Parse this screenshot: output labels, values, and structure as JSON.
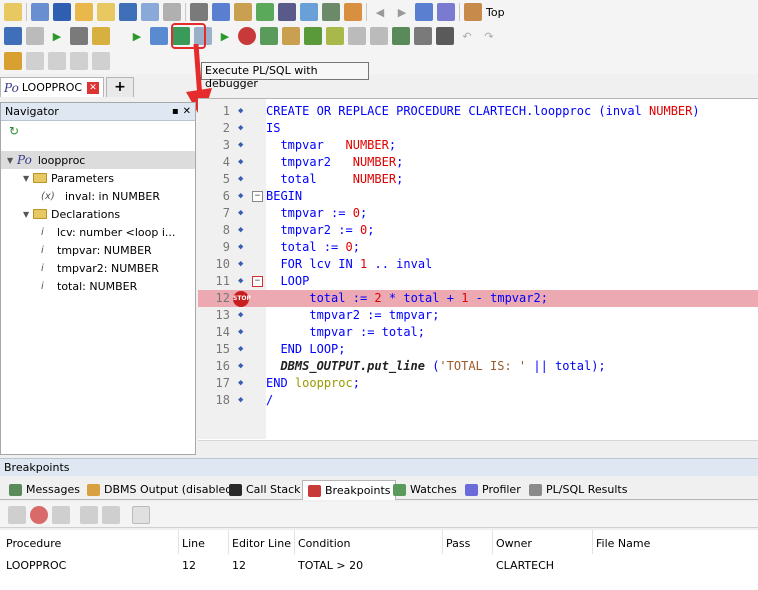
{
  "toolbar": {
    "top_label": "Top",
    "execute_debugger_tooltip": "Execute PL/SQL with debugger"
  },
  "tabs": {
    "document_prefix": "Po",
    "document": "LOOPPROC",
    "add": "+"
  },
  "navigator": {
    "title": "Navigator",
    "tree": [
      {
        "label": "loopproc",
        "prefix": "Po",
        "level": 0
      },
      {
        "label": "Parameters",
        "level": 1
      },
      {
        "label": "inval: in NUMBER",
        "prefix": "(x)",
        "level": 2
      },
      {
        "label": "Declarations",
        "level": 1
      },
      {
        "label": "lcv: number <loop i...",
        "level": 2
      },
      {
        "label": "tmpvar: NUMBER",
        "level": 2
      },
      {
        "label": "tmpvar2: NUMBER",
        "level": 2
      },
      {
        "label": "total: NUMBER",
        "level": 2
      }
    ]
  },
  "editor": {
    "breakpoint_line": 12,
    "lines": [
      "CREATE OR REPLACE PROCEDURE CLARTECH.loopproc (inval NUMBER)",
      "IS",
      "  tmpvar   NUMBER;",
      "  tmpvar2   NUMBER;",
      "  total     NUMBER;",
      "BEGIN",
      "  tmpvar := 0;",
      "  tmpvar2 := 0;",
      "  total := 0;",
      "  FOR lcv IN 1 .. inval",
      "  LOOP",
      "      total := 2 * total + 1 - tmpvar2;",
      "      tmpvar2 := tmpvar;",
      "      tmpvar := total;",
      "  END LOOP;",
      "  DBMS_OUTPUT.put_line ('TOTAL IS: ' || total);",
      "END loopproc;",
      "/"
    ]
  },
  "bottom": {
    "section_title": "Breakpoints",
    "tabs": [
      "Messages",
      "DBMS Output (disabled)",
      "Call Stack",
      "Breakpoints",
      "Watches",
      "Profiler",
      "PL/SQL Results"
    ],
    "active_tab": "Breakpoints",
    "columns": [
      "Procedure",
      "Line",
      "Editor Line",
      "Condition",
      "Pass",
      "Owner",
      "File Name"
    ],
    "rows": [
      [
        "LOOPPROC",
        "12",
        "12",
        "TOTAL > 20",
        "",
        "CLARTECH",
        ""
      ]
    ]
  }
}
